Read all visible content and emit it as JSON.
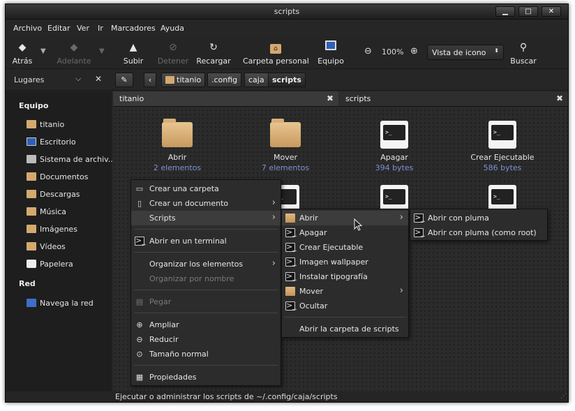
{
  "window": {
    "title": "scripts",
    "btn_min": "▁",
    "btn_max": "□",
    "btn_close": "✕"
  },
  "menubar": [
    "Archivo",
    "Editar",
    "Ver",
    "Ir",
    "Marcadores",
    "Ayuda"
  ],
  "toolbar": {
    "back": "Atrás",
    "forward": "Adelante",
    "up": "Subir",
    "stop": "Detener",
    "reload": "Recargar",
    "home": "Carpeta personal",
    "computer": "Equipo",
    "zoom": "100%",
    "view_mode": "Vista de icono",
    "search": "Buscar"
  },
  "location": {
    "places_label": "Lugares",
    "crumbs": [
      "titanio",
      ".config",
      "caja",
      "scripts"
    ]
  },
  "sidebar": {
    "section1": "Equipo",
    "items1": [
      "titanio",
      "Escritorio",
      "Sistema de archiv...",
      "Documentos",
      "Descargas",
      "Música",
      "Imágenes",
      "Vídeos",
      "Papelera"
    ],
    "section2": "Red",
    "items2": [
      "Navega la red"
    ]
  },
  "tabs": [
    {
      "label": "titanio"
    },
    {
      "label": "scripts"
    }
  ],
  "files": [
    {
      "name": "Abrir",
      "info": "2 elementos",
      "kind": "folder"
    },
    {
      "name": "Mover",
      "info": "7 elementos",
      "kind": "folder"
    },
    {
      "name": "Apagar",
      "info": "394 bytes",
      "kind": "script"
    },
    {
      "name": "Crear Ejecutable",
      "info": "586 bytes",
      "kind": "script"
    }
  ],
  "context_menu": {
    "create_folder": "Crear una carpeta",
    "create_doc": "Crear un documento",
    "scripts": "Scripts",
    "open_terminal": "Abrir en un terminal",
    "organize": "Organizar los elementos",
    "organize_name": "Organizar por nombre",
    "paste": "Pegar",
    "zoom_in": "Ampliar",
    "zoom_out": "Reducir",
    "normal_size": "Tamaño normal",
    "properties": "Propiedades"
  },
  "scripts_menu": {
    "items": [
      "Abrir",
      "Apagar",
      "Crear Ejecutable",
      "Imagen wallpaper",
      "Instalar tipografía",
      "Mover",
      "Ocultar"
    ],
    "open_folder": "Abrir la carpeta de scripts"
  },
  "abrir_menu": {
    "items": [
      "Abrir con pluma",
      "Abrir con pluma (como root)"
    ]
  },
  "status": "Ejecutar o administrar los scripts de ~/.config/caja/scripts",
  "term_glyph": ">_",
  "colors": {
    "accent_size": "#7f8fd6",
    "folder": "#d4a96f"
  }
}
